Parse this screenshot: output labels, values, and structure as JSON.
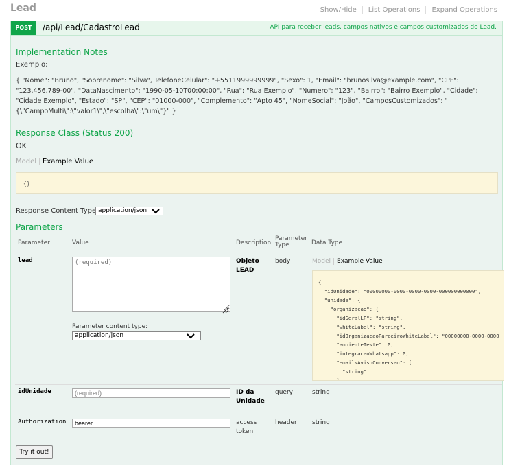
{
  "section": {
    "title": "Lead",
    "links": [
      "Show/Hide",
      "List Operations",
      "Expand Operations"
    ]
  },
  "operation": {
    "method": "POST",
    "path": "/api/Lead/CadastroLead",
    "summary": "API para receber leads. campos nativos e campos customizados do Lead."
  },
  "notes": {
    "heading": "Implementation Notes",
    "intro": "Exemplo:",
    "body": "{ \"Nome\": \"Bruno\", \"Sobrenome\": \"Silva\", TelefoneCelular\": \"+5511999999999\", \"Sexo\": 1, \"Email\": \"brunosilva@example.com\", \"CPF\": \"123.456.789-00\", \"DataNascimento\": \"1990-05-10T00:00:00\", \"Rua\": \"Rua Exemplo\", \"Numero\": \"123\", \"Bairro\": \"Bairro Exemplo\", \"Cidade\": \"Cidade Exemplo\", \"Estado\": \"SP\", \"CEP\": \"01000-000\", \"Complemento\": \"Apto 45\", \"NomeSocial\": \"João\", \"CamposCustomizados\": \"{\\\"CampoMulti\\\":\\\"valor1\\\",\\\"escolha\\\":\\\"um\\\"}\" }"
  },
  "response": {
    "heading": "Response Class (Status 200)",
    "status_text": "OK",
    "tab_model": "Model",
    "tab_example": "Example Value",
    "example": "{}",
    "content_type_label": "Response Content Type",
    "content_type_value": "application/json"
  },
  "parameters": {
    "heading": "Parameters",
    "columns": {
      "parameter": "Parameter",
      "value": "Value",
      "description": "Description",
      "type_line1": "Parameter",
      "type_line2": "Type",
      "data_type": "Data Type"
    },
    "lead": {
      "name": "lead",
      "placeholder": "(required)",
      "content_type_label": "Parameter content type:",
      "content_type_value": "application/json",
      "description_line1": "Objeto",
      "description_line2": "LEAD",
      "param_type": "body",
      "tab_model": "Model",
      "tab_example": "Example Value",
      "example_json": "{\n  \"idUnidade\": \"00000000-0000-0000-0000-000000000000\",\n  \"unidade\": {\n    \"organizacao\": {\n      \"idGeralLP\": \"string\",\n      \"whiteLabel\": \"string\",\n      \"idOrganizacaoParceiroWhiteLabel\": \"00000000-0000-0000\n      \"ambienteTeste\": 0,\n      \"integracaoWhatsapp\": 0,\n      \"emailsAvisoConversao\": [\n        \"string\"\n      ],"
    },
    "idUnidade": {
      "name": "idUnidade",
      "placeholder": "(required)",
      "description_line1": "ID da",
      "description_line2": "Unidade",
      "param_type": "query",
      "data_type": "string"
    },
    "authorization": {
      "name": "Authorization",
      "value": "bearer",
      "description_line1": "access",
      "description_line2": "token",
      "param_type": "header",
      "data_type": "string"
    }
  },
  "try_button": "Try it out!"
}
